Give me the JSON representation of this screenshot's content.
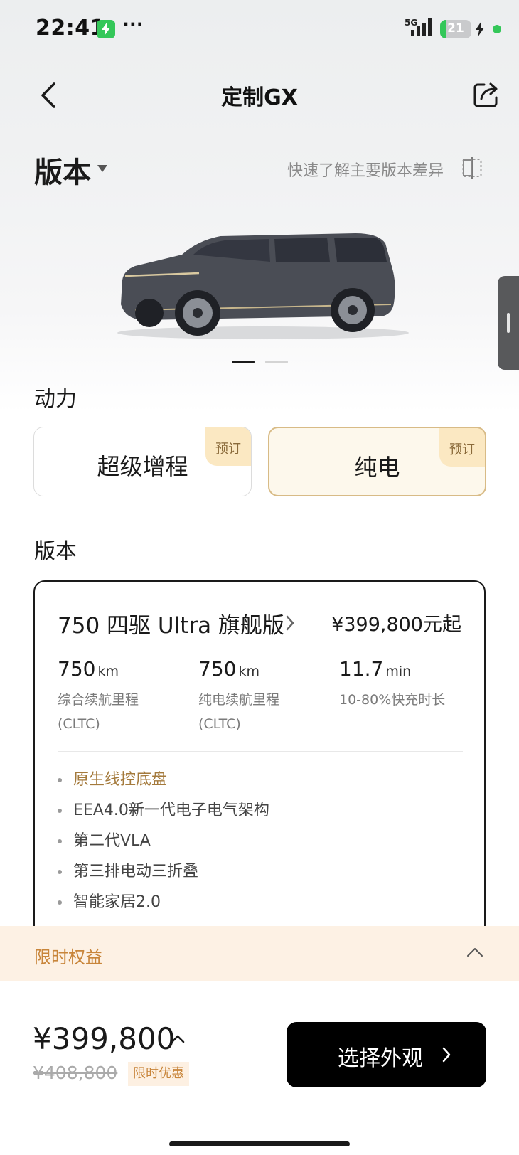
{
  "status_bar": {
    "time": "22:41",
    "more": "···",
    "network": "5G",
    "battery": "21",
    "battery_fraction": 0.21
  },
  "header": {
    "title": "定制GX"
  },
  "version_header": {
    "label": "版本",
    "compare_link": "快速了解主要版本差异"
  },
  "carousel": {
    "count": 2,
    "active_index": 0
  },
  "power": {
    "label": "动力",
    "options": [
      {
        "label": "超级增程",
        "badge": "预订",
        "selected": false
      },
      {
        "label": "纯电",
        "badge": "预订",
        "selected": true
      }
    ]
  },
  "version_section": {
    "label": "版本"
  },
  "trim": {
    "name": "750 四驱 Ultra 旗舰版",
    "price": "¥399,800元起",
    "specs": [
      {
        "value": "750",
        "unit": "km",
        "desc_line1": "综合续航里程",
        "desc_line2": "(CLTC)"
      },
      {
        "value": "750",
        "unit": "km",
        "desc_line1": "纯电续航里程",
        "desc_line2": "(CLTC)"
      },
      {
        "value": "11.7",
        "unit": "min",
        "desc_line1": "10-80%快充时长",
        "desc_line2": ""
      }
    ],
    "features": [
      "原生线控底盘",
      "EEA4.0新一代电子电气架构",
      "第二代VLA",
      "第三排电动三折叠",
      "智能家居2.0"
    ]
  },
  "promo": {
    "label": "限时权益"
  },
  "bottom": {
    "price": "¥399,800",
    "original_price": "¥408,800",
    "discount_badge": "限时优惠",
    "cta_label": "选择外观"
  },
  "colors": {
    "accent_gold": "#c8853a",
    "selected_border": "#d8bb86",
    "cta_bg": "#000000",
    "status_green": "#34c759"
  }
}
